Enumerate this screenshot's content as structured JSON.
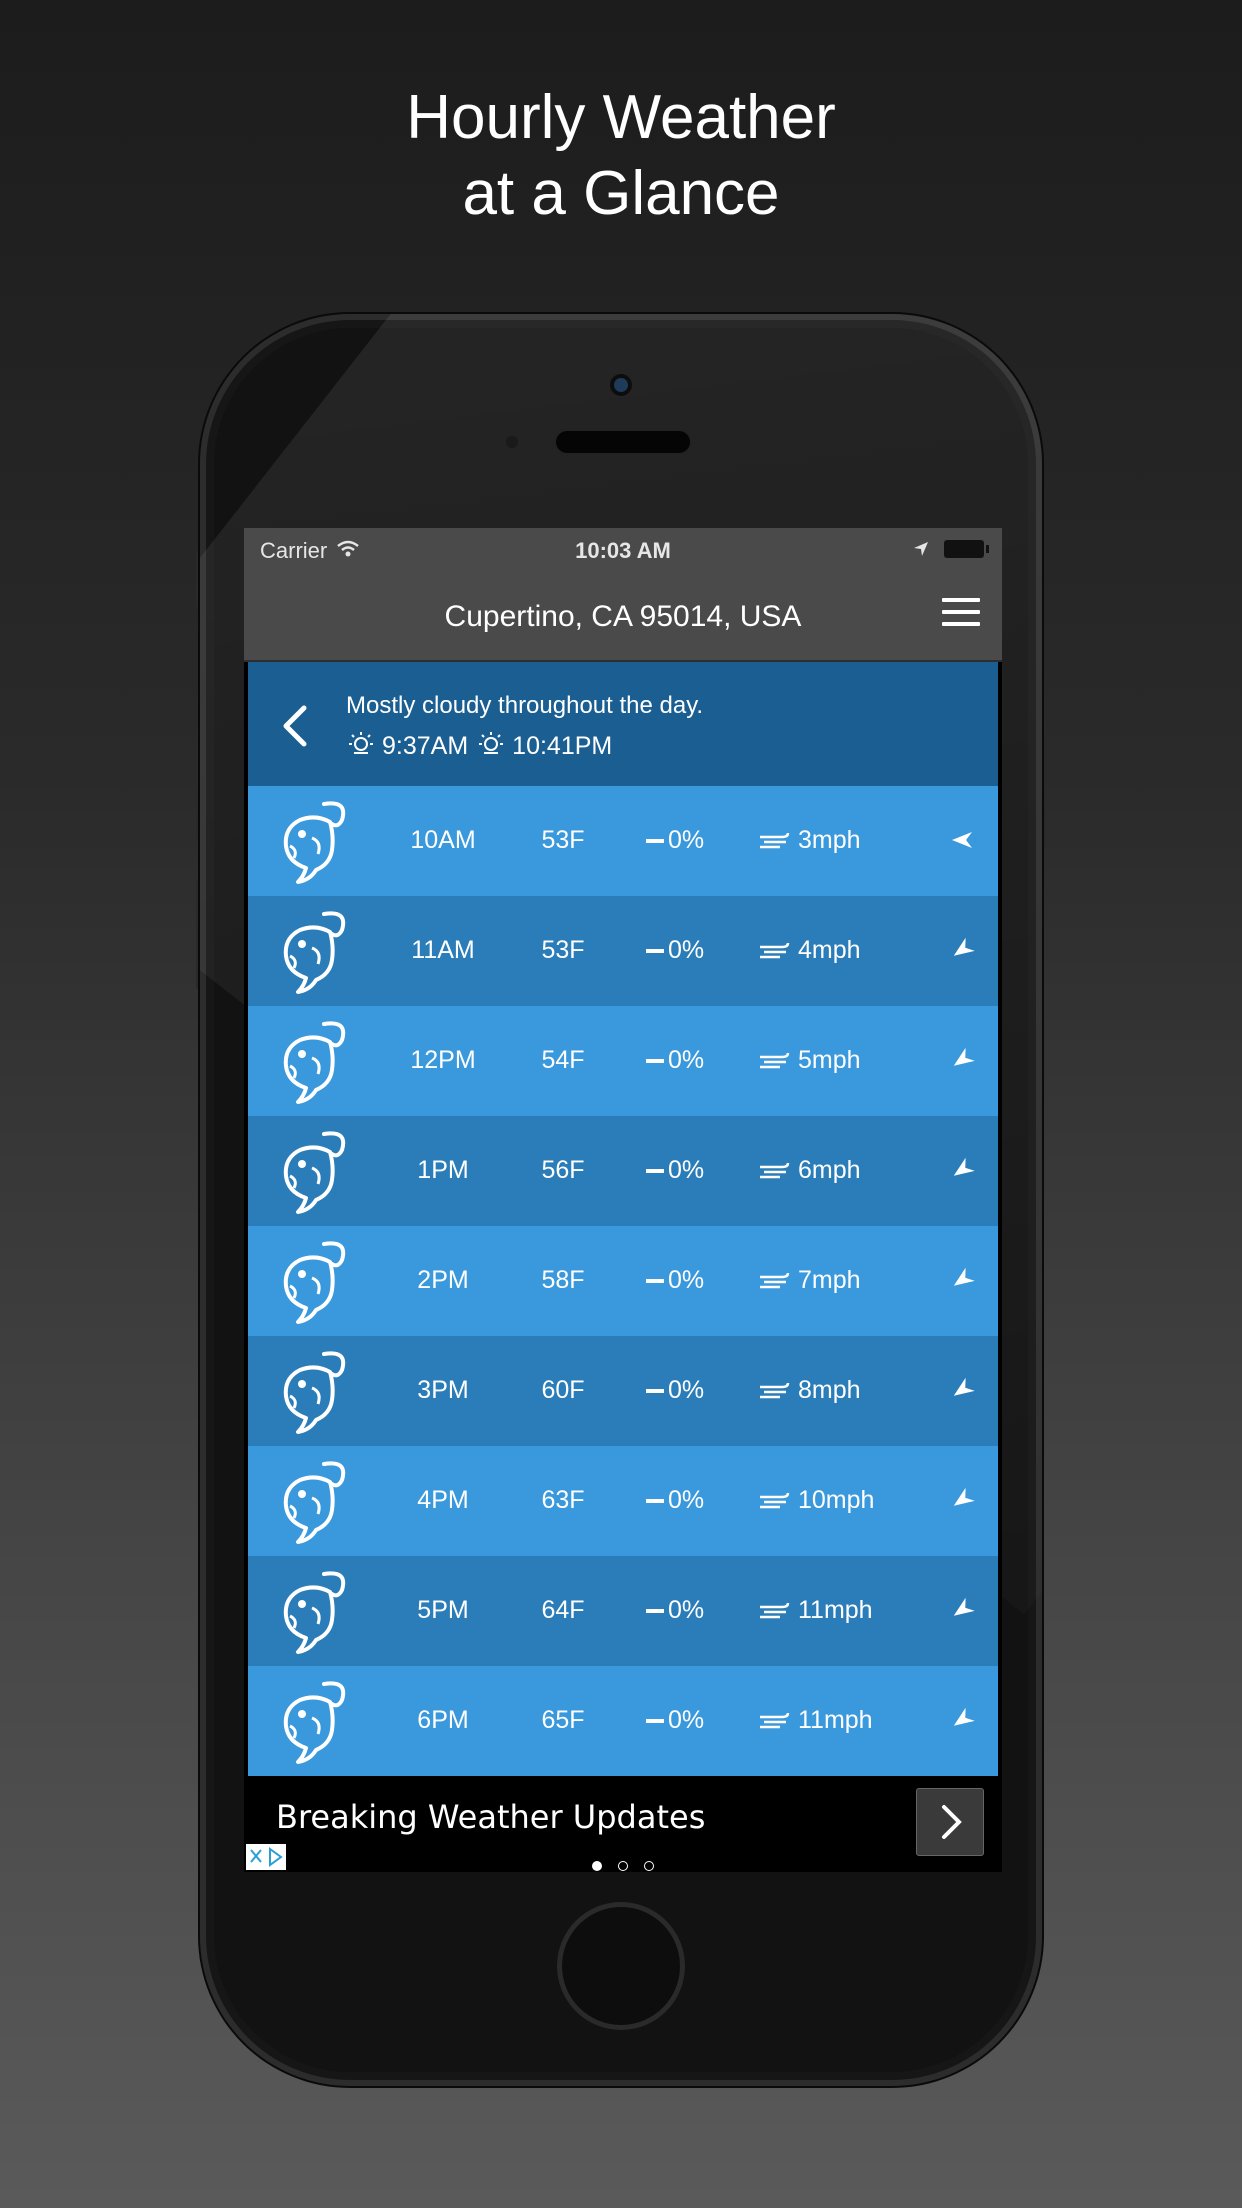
{
  "promo": {
    "line1": "Hourly Weather",
    "line2": "at a Glance"
  },
  "status_bar": {
    "carrier": "Carrier",
    "time": "10:03 AM"
  },
  "nav": {
    "title": "Cupertino, CA 95014, USA"
  },
  "summary": {
    "text": "Mostly cloudy throughout the day.",
    "sunrise": "9:37AM",
    "sunset": "10:41PM"
  },
  "hours": [
    {
      "hour": "10AM",
      "temp": "53F",
      "precip": "0%",
      "wind": "3mph"
    },
    {
      "hour": "11AM",
      "temp": "53F",
      "precip": "0%",
      "wind": "4mph"
    },
    {
      "hour": "12PM",
      "temp": "54F",
      "precip": "0%",
      "wind": "5mph"
    },
    {
      "hour": "1PM",
      "temp": "56F",
      "precip": "0%",
      "wind": "6mph"
    },
    {
      "hour": "2PM",
      "temp": "58F",
      "precip": "0%",
      "wind": "7mph"
    },
    {
      "hour": "3PM",
      "temp": "60F",
      "precip": "0%",
      "wind": "8mph"
    },
    {
      "hour": "4PM",
      "temp": "63F",
      "precip": "0%",
      "wind": "10mph"
    },
    {
      "hour": "5PM",
      "temp": "64F",
      "precip": "0%",
      "wind": "11mph"
    },
    {
      "hour": "6PM",
      "temp": "65F",
      "precip": "0%",
      "wind": "11mph"
    }
  ],
  "ad": {
    "text": "Breaking Weather Updates"
  },
  "colors": {
    "row_light": "#3a98dc",
    "row_dark": "#2a7db8",
    "summary_bg": "#1b5f92",
    "nav_bg": "#4a4a4a"
  }
}
